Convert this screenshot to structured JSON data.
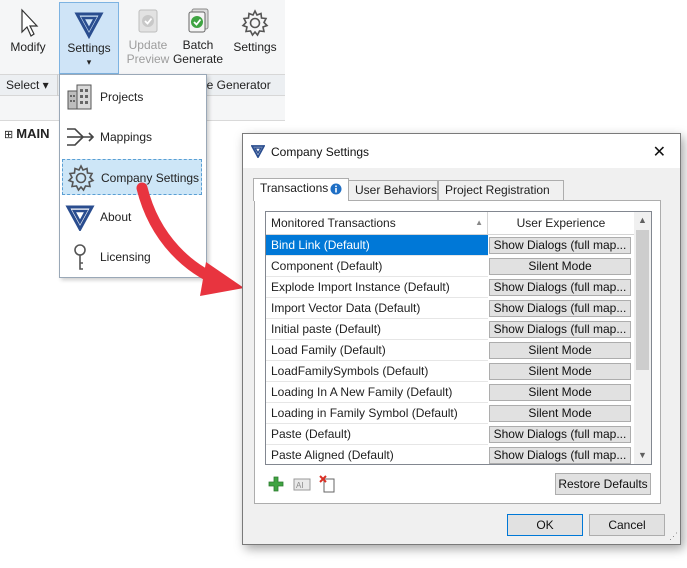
{
  "ribbon": {
    "buttons": [
      {
        "id": "modify",
        "label": "Modify"
      },
      {
        "id": "settings",
        "label": "Settings",
        "arrow": "▾"
      },
      {
        "id": "update_preview",
        "label1": "Update",
        "label2": "Preview"
      },
      {
        "id": "batch_generate",
        "label1": "Batch",
        "label2": "Generate"
      },
      {
        "id": "settings2",
        "label": "Settings"
      }
    ],
    "panels": {
      "select": "Select ▾",
      "generator": "ge Generator"
    }
  },
  "main_label": "MAIN",
  "dropdown": {
    "items": [
      {
        "label": "Projects",
        "icon": "building-icon"
      },
      {
        "label": "Mappings",
        "icon": "mappings-icon"
      },
      {
        "label": "Company Settings",
        "icon": "gear-icon"
      },
      {
        "label": "About",
        "icon": "logo-icon"
      },
      {
        "label": "Licensing",
        "icon": "key-icon"
      }
    ]
  },
  "dialog": {
    "title": "Company Settings",
    "close": "✕",
    "tabs": [
      {
        "label": "Transactions"
      },
      {
        "label": "User Behaviors"
      },
      {
        "label": "Project Registration"
      }
    ],
    "grid": {
      "headers": [
        "Monitored Transactions",
        "User Experience"
      ],
      "sort_glyph": "▲",
      "rows": [
        {
          "name": "Bind Link (Default)",
          "exp": "Show Dialogs (full map..."
        },
        {
          "name": "Component (Default)",
          "exp": "Silent Mode"
        },
        {
          "name": "Explode Import Instance (Default)",
          "exp": "Show Dialogs (full map..."
        },
        {
          "name": "Import Vector Data (Default)",
          "exp": "Show Dialogs (full map..."
        },
        {
          "name": "Initial paste (Default)",
          "exp": "Show Dialogs (full map..."
        },
        {
          "name": "Load Family (Default)",
          "exp": "Silent Mode"
        },
        {
          "name": "LoadFamilySymbols (Default)",
          "exp": "Silent Mode"
        },
        {
          "name": "Loading In A New Family (Default)",
          "exp": "Silent Mode"
        },
        {
          "name": "Loading in Family Symbol (Default)",
          "exp": "Silent Mode"
        },
        {
          "name": "Paste (Default)",
          "exp": "Show Dialogs (full map..."
        },
        {
          "name": "Paste Aligned (Default)",
          "exp": "Show Dialogs (full map..."
        }
      ]
    },
    "restore_defaults": "Restore Defaults",
    "ok": "OK",
    "cancel": "Cancel"
  },
  "colors": {
    "selection": "#0078d7",
    "arrow": "#e8343f",
    "accent": "#2a4d8f"
  }
}
